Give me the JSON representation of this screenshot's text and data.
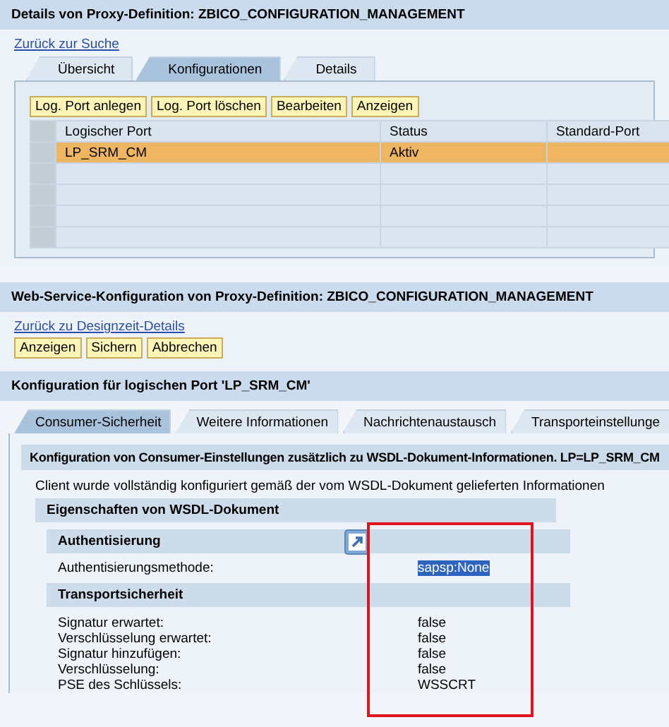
{
  "details_panel": {
    "title": "Details von Proxy-Definition: ZBICO_CONFIGURATION_MANAGEMENT",
    "back_link": "Zurück zur Suche",
    "tabs": [
      {
        "label": "Übersicht",
        "selected": false
      },
      {
        "label": "Konfigurationen",
        "selected": true
      },
      {
        "label": "Details",
        "selected": false
      }
    ],
    "buttons": [
      "Log. Port anlegen",
      "Log. Port löschen",
      "Bearbeiten",
      "Anzeigen"
    ],
    "table": {
      "columns": [
        "Logischer Port",
        "Status",
        "Standard-Port"
      ],
      "rows": [
        {
          "cells": [
            "LP_SRM_CM",
            "Aktiv"
          ],
          "selected": true
        },
        {
          "selected": false
        },
        {
          "selected": false
        },
        {
          "selected": false
        },
        {
          "selected": false
        }
      ]
    }
  },
  "config_panel": {
    "title": "Web-Service-Konfiguration von Proxy-Definition: ZBICO_CONFIGURATION_MANAGEMENT",
    "back_link": "Zurück zu Designzeit-Details",
    "buttons": [
      "Anzeigen",
      "Sichern",
      "Abbrechen"
    ]
  },
  "port_panel": {
    "title": "Konfiguration für logischen Port 'LP_SRM_CM'",
    "tabs": [
      {
        "label": "Consumer-Sicherheit",
        "selected": true
      },
      {
        "label": "Weitere Informationen",
        "selected": false
      },
      {
        "label": "Nachrichtenaustausch",
        "selected": false
      },
      {
        "label": "Transporteinstellunge",
        "selected": false
      }
    ],
    "subheader": "Konfiguration von Consumer-Einstellungen zusätzlich zu WSDL-Dokument-Informationen. LP=LP_SRM_CM",
    "info": "Client wurde vollständig konfiguriert gemäß der vom WSDL-Dokument gelieferten Informationen",
    "section_title": "Eigenschaften von WSDL-Dokument",
    "groups": [
      {
        "title": "Authentisierung",
        "fields": [
          {
            "label": "Authentisierungsmethode:",
            "value": "sapsp:None",
            "highlighted": true
          }
        ]
      },
      {
        "title": "Transportsicherheit",
        "fields": [
          {
            "label": "Signatur erwartet:",
            "value": "false",
            "highlighted": false
          },
          {
            "label": "Verschlüsselung erwartet:",
            "value": "false",
            "highlighted": false
          },
          {
            "label": "Signatur hinzufügen:",
            "value": "false",
            "highlighted": false
          },
          {
            "label": "Verschlüsselung:",
            "value": "false",
            "highlighted": false
          },
          {
            "label": "PSE des Schlüssels:",
            "value": "WSSCRT",
            "highlighted": false
          }
        ]
      }
    ]
  }
}
